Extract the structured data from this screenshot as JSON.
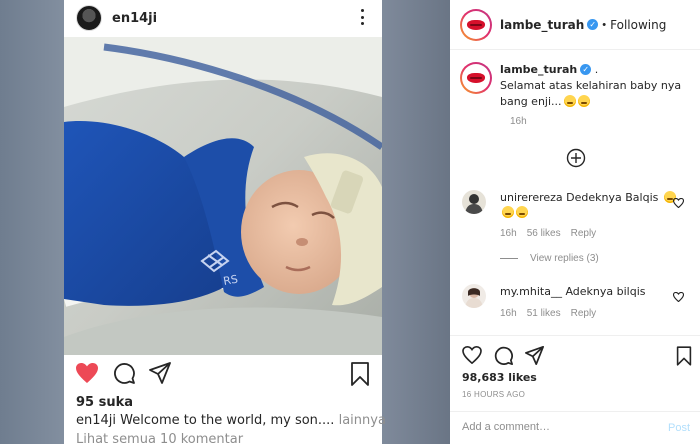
{
  "post": {
    "username": "en14ji",
    "likes": "95 suka",
    "caption_user": "en14ji",
    "caption_text": " Welcome to the world, my son....",
    "caption_more": " lainnya",
    "view_all": "Lihat semua 10 komentar",
    "photo_sleeve_logo": "RS"
  },
  "panel": {
    "username": "lambe_turah",
    "follow_label": "Following",
    "separator": "•",
    "caption": {
      "username": "lambe_turah",
      "suffix": " .",
      "text": "Selamat atas kelahiran baby nya bang enji...",
      "time": "16h"
    },
    "comments": [
      {
        "username": "unirerereza",
        "text": " Dedeknya Balqis",
        "time": "16h",
        "likes": "56 likes",
        "reply": "Reply"
      },
      {
        "username": "my.mhita__",
        "text": "  Adeknya bilqis",
        "time": "16h",
        "likes": "51 likes",
        "reply": "Reply"
      }
    ],
    "view_replies": "View replies (3)",
    "likes_count": "98,683 likes",
    "date": "16 HOURS AGO",
    "add_comment_placeholder": "Add a comment…",
    "post_label": "Post"
  },
  "colors": {
    "heart": "#ed4956",
    "verified": "#3897f0",
    "post_disabled": "#b2dffc",
    "brand_lips": "#d6102b"
  },
  "icons": [
    "more-icon",
    "heart-icon",
    "comment-icon",
    "share-icon",
    "save-icon",
    "verified-icon",
    "plus-circle-icon",
    "emoji-icon"
  ]
}
